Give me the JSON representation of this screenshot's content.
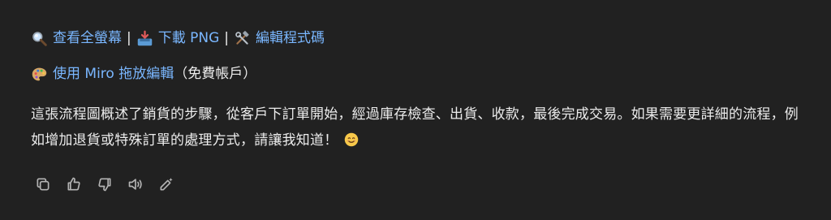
{
  "links": {
    "fullscreen_icon": "magnifier-icon",
    "fullscreen_label": "查看全螢幕",
    "download_icon": "inbox-tray-icon",
    "download_label": "下載 PNG",
    "edit_icon": "hammer-wrench-icon",
    "edit_label": "編輯程式碼",
    "separator": "|",
    "miro_icon": "palette-icon",
    "miro_label": "使用 Miro 拖放編輯",
    "miro_note": "（免費帳戶）"
  },
  "message": {
    "text": "這張流程圖概述了銷貨的步驟，從客戶下訂單開始，經過庫存檢查、出貨、收款，最後完成交易。如果需要更詳細的流程，例如增加退貨或特殊訂單的處理方式，請讓我知道！",
    "emoji": "smiling-face-icon"
  },
  "actions": [
    {
      "name": "copy-icon"
    },
    {
      "name": "thumbs-up-icon"
    },
    {
      "name": "thumbs-down-icon"
    },
    {
      "name": "read-aloud-icon"
    },
    {
      "name": "edit-magic-icon"
    }
  ],
  "colors": {
    "background": "#212121",
    "text": "#ececec",
    "link": "#7ab7ff",
    "icon": "#b4b4b4"
  }
}
